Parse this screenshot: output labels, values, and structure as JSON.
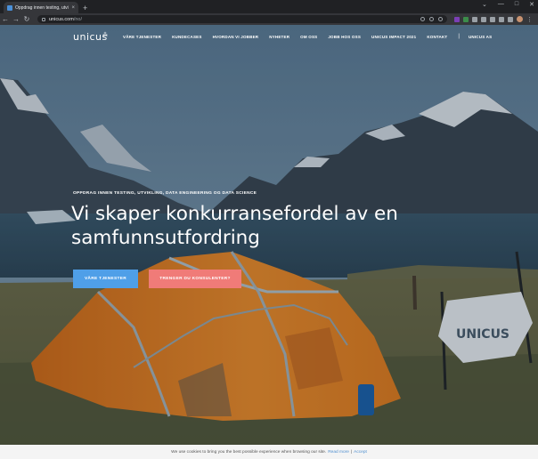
{
  "browser": {
    "tab_title": "Oppdrag innen testing, utvikling...",
    "tab_close": "×",
    "new_tab": "+",
    "url_host": "unicus.com",
    "url_path": "/no/",
    "window_controls": [
      "⌄",
      "—",
      "□",
      "✕"
    ]
  },
  "header": {
    "logo": "unicus",
    "menu": [
      "VÅRE TJENESTER",
      "KUNDECASES",
      "HVORDAN VI JOBBER",
      "NYHETER",
      "OM OSS",
      "JOBB HOS OSS",
      "UNICUS IMPACT 2021",
      "KONTAKT"
    ],
    "separator": "|",
    "company": "UNICUS AS"
  },
  "hero": {
    "eyebrow": "OPPDRAG INNEN TESTING, UTVIKLING, DATA ENGINEERING OG DATA SCIENCE",
    "headline_line1": "Vi skaper konkurransefordel av en",
    "headline_line2": "samfunnsutfordring",
    "primary_button": "VÅRE TJENESTER",
    "secondary_button": "TRENGER DU KONSULENTER?",
    "flag_text": "UNICUS"
  },
  "cookie": {
    "message": "We use cookies to bring you the best possible experience when browsing our site.",
    "read_more": "Read more",
    "divider": "|",
    "accept": "Accept"
  },
  "colors": {
    "primary_button": "#4f9fe8",
    "secondary_button": "#f07b78",
    "tent": "#e8801f"
  }
}
